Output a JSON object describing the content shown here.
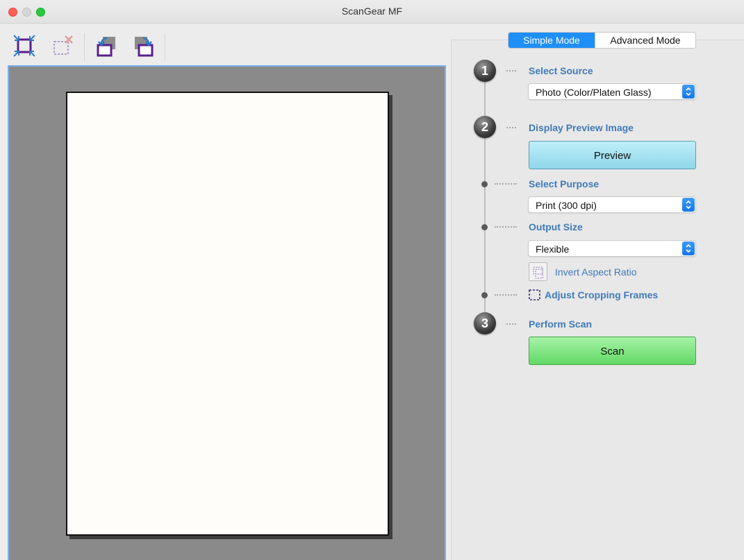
{
  "window": {
    "title": "ScanGear MF"
  },
  "toolbar": {
    "items": [
      {
        "name": "auto-crop-icon"
      },
      {
        "name": "remove-crop-icon"
      },
      {
        "name": "rotate-left-icon"
      },
      {
        "name": "rotate-right-icon"
      }
    ]
  },
  "modes": {
    "simple": "Simple Mode",
    "advanced": "Advanced Mode",
    "active": "simple"
  },
  "steps": {
    "source": {
      "number": "1",
      "label": "Select Source",
      "value": "Photo (Color/Platen Glass)"
    },
    "preview": {
      "number": "2",
      "label": "Display Preview Image",
      "button": "Preview"
    },
    "purpose": {
      "label": "Select Purpose",
      "value": "Print (300 dpi)"
    },
    "output": {
      "label": "Output Size",
      "value": "Flexible",
      "invert_label": "Invert Aspect Ratio"
    },
    "crop": {
      "label": "Adjust Cropping Frames"
    },
    "scan": {
      "number": "3",
      "label": "Perform Scan",
      "button": "Scan"
    }
  },
  "colors": {
    "accent_blue": "#1e8ff6",
    "label_blue": "#3f7ab8",
    "preview_button": "#a6e3f1",
    "scan_button": "#7ee27f",
    "crop_purple": "#5a1f8c"
  }
}
